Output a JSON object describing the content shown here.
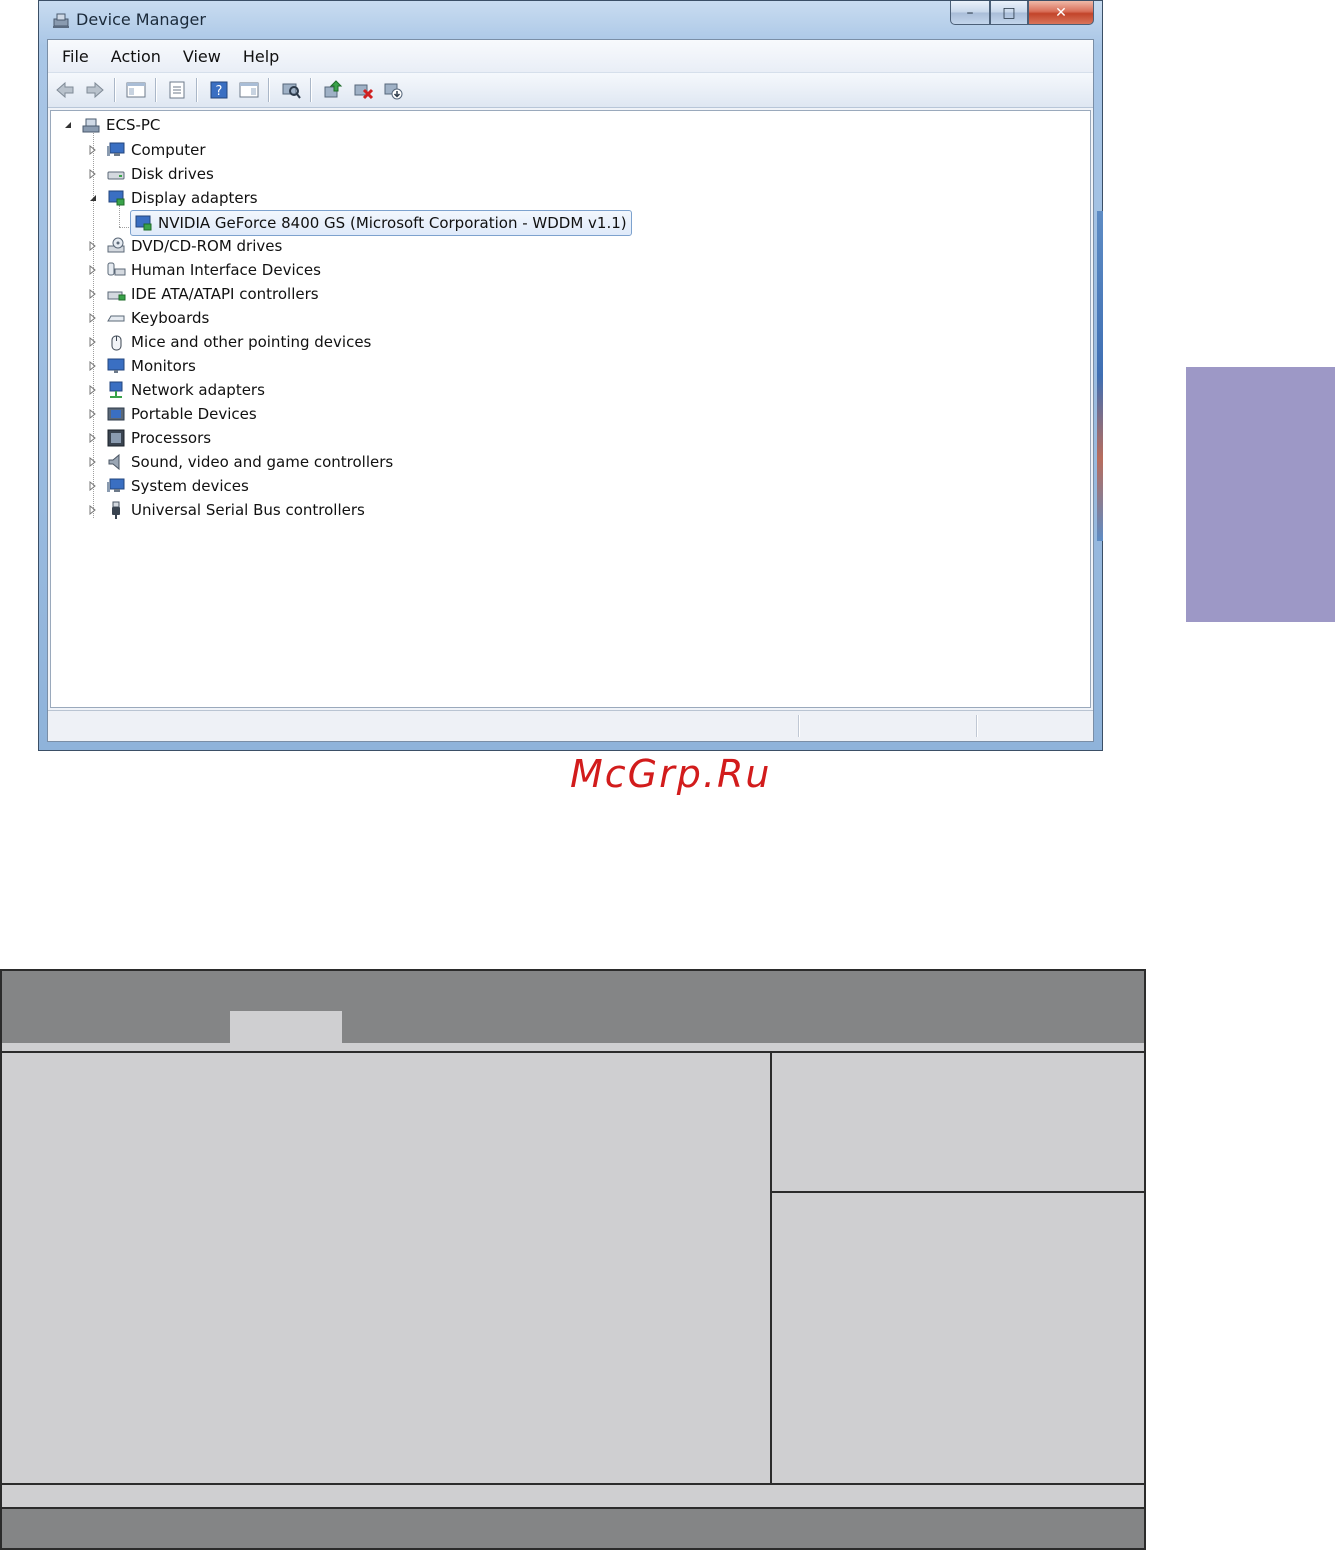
{
  "window": {
    "title": "Device Manager",
    "controls": {
      "minimize": "–",
      "maximize": "□",
      "close": "✕"
    }
  },
  "menu": [
    "File",
    "Action",
    "View",
    "Help"
  ],
  "toolbar_icons": [
    "back-icon",
    "forward-icon",
    "show-hide-console-tree-icon",
    "properties-icon",
    "help-icon",
    "action-pane-icon",
    "scan-hardware-icon",
    "update-driver-icon",
    "disable-device-icon",
    "uninstall-icon"
  ],
  "tree": {
    "root": "ECS-PC",
    "categories": [
      "Computer",
      "Disk drives",
      "Display adapters",
      "DVD/CD-ROM drives",
      "Human Interface Devices",
      "IDE ATA/ATAPI controllers",
      "Keyboards",
      "Mice and other pointing devices",
      "Monitors",
      "Network adapters",
      "Portable Devices",
      "Processors",
      "Sound, video and game controllers",
      "System devices",
      "Universal Serial Bus controllers"
    ],
    "expanded_category": "Display adapters",
    "selected_device": "NVIDIA GeForce 8400 GS (Microsoft Corporation - WDDM v1.1)"
  },
  "watermark": "McGrp.Ru",
  "colors": {
    "side_tab": "#9d98c6",
    "bios_bar": "#848586",
    "bios_panel": "#cfcfd1",
    "watermark": "#d21c1c"
  }
}
